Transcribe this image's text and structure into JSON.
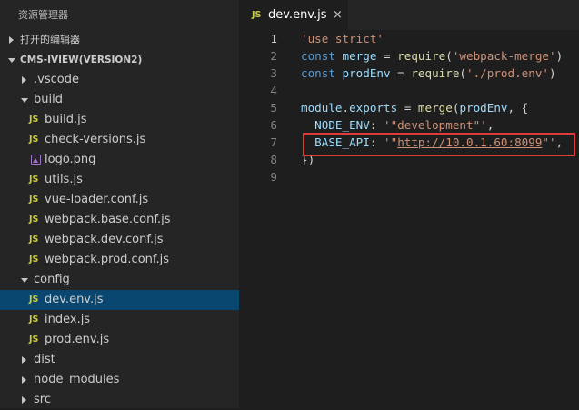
{
  "explorer": {
    "title": "资源管理器",
    "open_editors": "打开的编辑器",
    "project": "CMS-IVIEW(VERSION2)",
    "tree": [
      {
        "label": ".vscode",
        "kind": "folder",
        "state": "collapsed"
      },
      {
        "label": "build",
        "kind": "folder",
        "state": "expanded"
      },
      {
        "label": "build.js",
        "kind": "js"
      },
      {
        "label": "check-versions.js",
        "kind": "js"
      },
      {
        "label": "logo.png",
        "kind": "image"
      },
      {
        "label": "utils.js",
        "kind": "js"
      },
      {
        "label": "vue-loader.conf.js",
        "kind": "js"
      },
      {
        "label": "webpack.base.conf.js",
        "kind": "js"
      },
      {
        "label": "webpack.dev.conf.js",
        "kind": "js"
      },
      {
        "label": "webpack.prod.conf.js",
        "kind": "js"
      },
      {
        "label": "config",
        "kind": "folder",
        "state": "expanded"
      },
      {
        "label": "dev.env.js",
        "kind": "js",
        "selected": true
      },
      {
        "label": "index.js",
        "kind": "js"
      },
      {
        "label": "prod.env.js",
        "kind": "js"
      },
      {
        "label": "dist",
        "kind": "folder",
        "state": "collapsed"
      },
      {
        "label": "node_modules",
        "kind": "folder",
        "state": "collapsed"
      },
      {
        "label": "src",
        "kind": "folder",
        "state": "collapsed"
      }
    ],
    "js_badge": "JS"
  },
  "editor": {
    "tab": {
      "label": "dev.env.js",
      "badge": "JS",
      "close": "×"
    },
    "active_line": 1,
    "lines": [
      [
        {
          "t": "'use strict'",
          "c": "str"
        }
      ],
      [
        {
          "t": "const ",
          "c": "kw"
        },
        {
          "t": "merge",
          "c": "var"
        },
        {
          "t": " = ",
          "c": "pl"
        },
        {
          "t": "require",
          "c": "fn"
        },
        {
          "t": "(",
          "c": "pl"
        },
        {
          "t": "'webpack-merge'",
          "c": "str"
        },
        {
          "t": ")",
          "c": "pl"
        }
      ],
      [
        {
          "t": "const ",
          "c": "kw"
        },
        {
          "t": "prodEnv",
          "c": "var"
        },
        {
          "t": " = ",
          "c": "pl"
        },
        {
          "t": "require",
          "c": "fn"
        },
        {
          "t": "(",
          "c": "pl"
        },
        {
          "t": "'./prod.env'",
          "c": "str"
        },
        {
          "t": ")",
          "c": "pl"
        }
      ],
      [],
      [
        {
          "t": "module",
          "c": "var"
        },
        {
          "t": ".",
          "c": "pl"
        },
        {
          "t": "exports",
          "c": "var"
        },
        {
          "t": " = ",
          "c": "pl"
        },
        {
          "t": "merge",
          "c": "fn"
        },
        {
          "t": "(",
          "c": "pl"
        },
        {
          "t": "prodEnv",
          "c": "var"
        },
        {
          "t": ", {",
          "c": "pl"
        }
      ],
      [
        {
          "t": "  ",
          "c": "pl"
        },
        {
          "t": "NODE_ENV",
          "c": "var"
        },
        {
          "t": ": ",
          "c": "pl"
        },
        {
          "t": "'\"development\"'",
          "c": "str"
        },
        {
          "t": ",",
          "c": "pl"
        }
      ],
      [
        {
          "t": "  ",
          "c": "pl"
        },
        {
          "t": "BASE_API",
          "c": "var"
        },
        {
          "t": ": ",
          "c": "pl"
        },
        {
          "t": "'\"",
          "c": "str"
        },
        {
          "t": "http://10.0.1.60:8099",
          "c": "str ul"
        },
        {
          "t": "\"'",
          "c": "str"
        },
        {
          "t": ",",
          "c": "pl"
        }
      ],
      [
        {
          "t": "})",
          "c": "pl"
        }
      ],
      []
    ]
  },
  "colors": {
    "highlight_box": "#e03c3c",
    "selection": "#094771",
    "js_badge": "#cbcb41",
    "image_icon": "#a074c4"
  }
}
